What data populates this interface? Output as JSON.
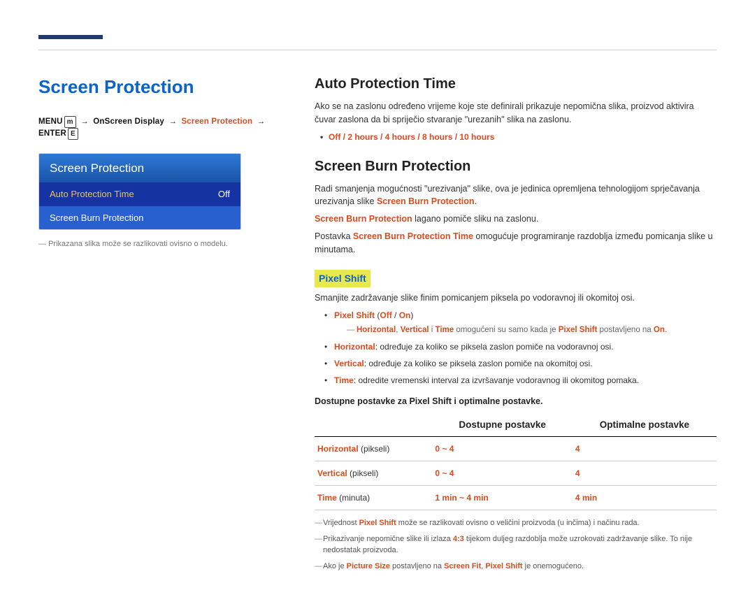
{
  "left": {
    "title": "Screen Protection",
    "breadcrumb": {
      "menu": "MENU",
      "menu_icon": "m",
      "p1": "OnScreen Display",
      "p2": "Screen Protection",
      "enter": "ENTER",
      "enter_icon": "E"
    },
    "menu": {
      "header": "Screen Protection",
      "items": [
        {
          "label": "Auto Protection Time",
          "value": "Off",
          "selected": true
        },
        {
          "label": "Screen Burn Protection",
          "value": "",
          "selected": false
        }
      ]
    },
    "footnote": "Prikazana slika može se razlikovati ovisno o modelu."
  },
  "right": {
    "sec1": {
      "title": "Auto Protection Time",
      "p": "Ako se na zaslonu određeno vrijeme koje ste definirali prikazuje nepomična slika, proizvod aktivira čuvar zaslona da bi spriječio stvaranje \"urezanih\" slika na zaslonu.",
      "options": "Off / 2 hours / 4 hours / 8 hours / 10 hours"
    },
    "sec2": {
      "title": "Screen Burn Protection",
      "p1_a": "Radi smanjenja mogućnosti \"urezivanja\" slike, ova je jedinica opremljena tehnologijom sprječavanja urezivanja slike ",
      "p1_red": "Screen Burn Protection",
      "p1_b": ".",
      "p2_red": "Screen Burn Protection",
      "p2_rest": " lagano pomiče sliku na zaslonu.",
      "p3_a": "Postavka ",
      "p3_red": "Screen Burn Protection Time",
      "p3_b": " omogućuje programiranje razdoblja između pomicanja slike u minutama."
    },
    "pixel": {
      "tag": "Pixel Shift",
      "desc": "Smanjite zadržavanje slike finim pomicanjem piksela po vodoravnoj ili okomitoj osi.",
      "b1_red": "Pixel Shift",
      "b1_paren_a": " (",
      "b1_off": "Off",
      "b1_slash": " / ",
      "b1_on": "On",
      "b1_paren_b": ")",
      "sub_red1": "Horizontal",
      "sub_comma": ", ",
      "sub_red2": "Vertical",
      "sub_i": " i ",
      "sub_red3": "Time",
      "sub_mid": " omogućeni su samo kada je ",
      "sub_red4": "Pixel Shift",
      "sub_post_a": " postavljeno na ",
      "sub_red5": "On",
      "sub_end": ".",
      "b2_red": "Horizontal",
      "b2_rest": ": određuje za koliko se piksela zaslon pomiče na vodoravnoj osi.",
      "b3_red": "Vertical",
      "b3_rest": ": određuje za koliko se piksela zaslon pomiče na okomitoj osi.",
      "b4_red": "Time",
      "b4_rest": ": odredite vremenski interval za izvršavanje vodoravnog ili okomitog pomaka."
    },
    "table": {
      "caption": "Dostupne postavke za Pixel Shift i optimalne postavke.",
      "h1": "",
      "h2": "Dostupne postavke",
      "h3": "Optimalne postavke",
      "rows": [
        {
          "name": "Horizontal",
          "unit": " (pikseli)",
          "avail": "0 ~ 4",
          "opt": "4"
        },
        {
          "name": "Vertical",
          "unit": " (pikseli)",
          "avail": "0 ~ 4",
          "opt": "4"
        },
        {
          "name": "Time",
          "unit": " (minuta)",
          "avail": "1 min ~ 4 min",
          "opt": "4 min"
        }
      ]
    },
    "notes": {
      "n1_a": "Vrijednost ",
      "n1_red": "Pixel Shift",
      "n1_b": " može se razlikovati ovisno o veličini proizvoda (u inčima) i načinu rada.",
      "n2_a": "Prikazivanje nepomične slike ili izlaza ",
      "n2_red": "4:3",
      "n2_b": " tijekom duljeg razdoblja može uzrokovati zadržavanje slike. To nije nedostatak proizvoda.",
      "n3_a": "Ako je ",
      "n3_red1": "Picture Size",
      "n3_b": " postavljeno na ",
      "n3_red2": "Screen Fit",
      "n3_c": ", ",
      "n3_red3": "Pixel Shift",
      "n3_d": " je onemogućeno."
    }
  }
}
